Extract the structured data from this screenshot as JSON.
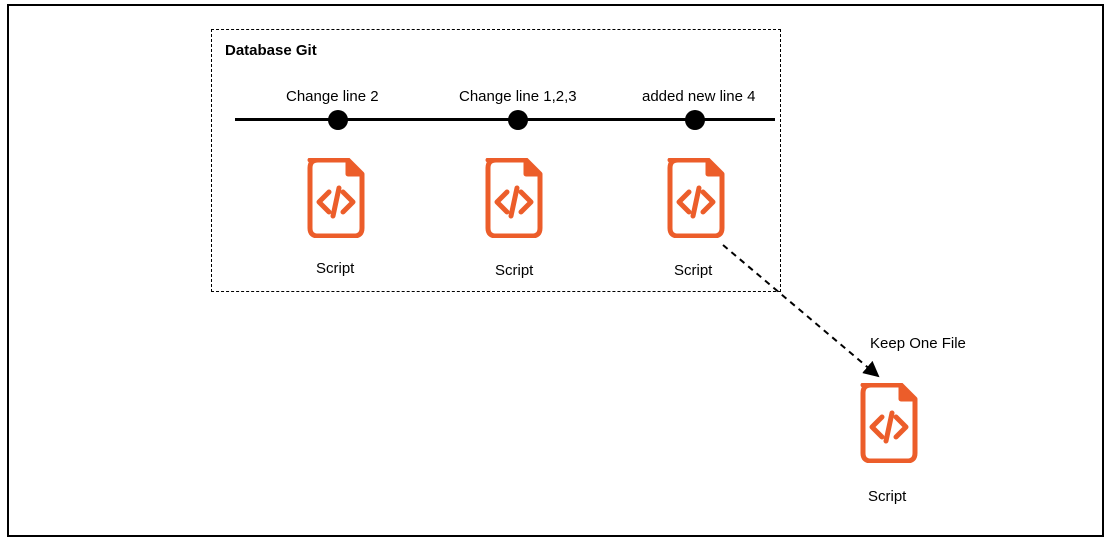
{
  "box_title": "Database Git",
  "commits": [
    {
      "label": "Change line 2"
    },
    {
      "label": "Change line 1,2,3"
    },
    {
      "label": "added new line 4"
    }
  ],
  "script_labels": {
    "s1": "Script",
    "s2": "Script",
    "s3": "Script",
    "s4": "Script"
  },
  "arrow_label": "Keep One File",
  "icon_color": "#ec5d2a"
}
